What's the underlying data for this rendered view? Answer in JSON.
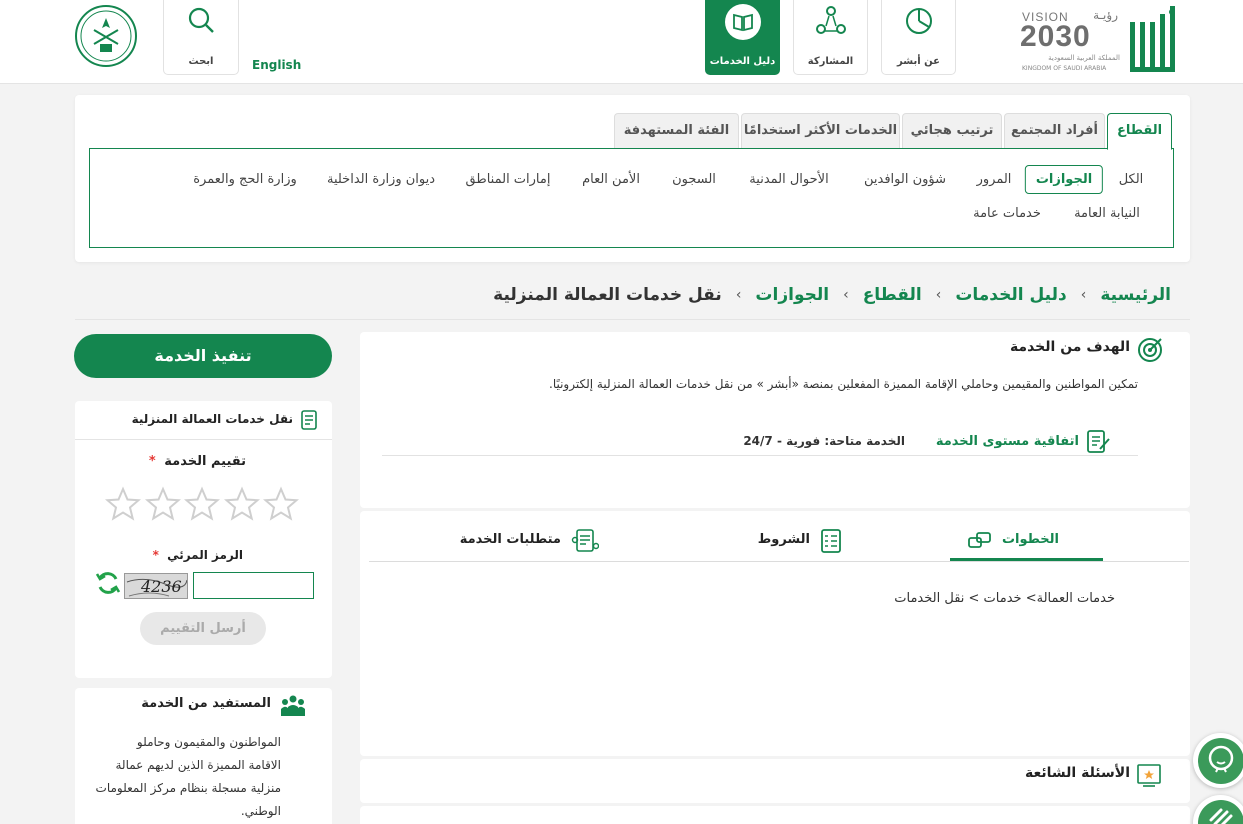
{
  "header": {
    "nav": {
      "about": "عن أبشر",
      "participation": "المشاركة",
      "services_guide": "دليل الخدمات",
      "search": "ابحث"
    },
    "english_link": "English",
    "vision": {
      "word": "VISION",
      "arabic_word": "رؤيـة",
      "year": "2030",
      "ksa_ar": "المملكة العربية السعودية",
      "ksa_en": "KINGDOM OF SAUDI ARABIA"
    },
    "absher_logo": "أبشر"
  },
  "sector_tabs": [
    "القطاع",
    "أفراد المجتمع",
    "ترتيب هجائي",
    "الخدمات الأكثر استخدامًا",
    "الفئة المستهدفة"
  ],
  "sectors_row1": [
    "الكل",
    "الجوازات",
    "المرور",
    "شؤون الوافدين",
    "الأحوال المدنية",
    "السجون",
    "الأمن العام",
    "إمارات المناطق",
    "ديوان وزارة الداخلية",
    "وزارة الحج والعمرة"
  ],
  "sectors_row2": [
    "النيابة العامة",
    "خدمات عامة"
  ],
  "selected_sector": "الجوازات",
  "breadcrumb": {
    "home": "الرئيسية",
    "guide": "دليل الخدمات",
    "sector": "القطاع",
    "passports": "الجوازات",
    "current": "نقل خدمات العمالة المنزلية",
    "separator": "›"
  },
  "goal": {
    "title": "الهدف من الخدمة",
    "text": "تمكين المواطنين والمقيمين وحاملي الإقامة المميزة المفعلين بمنصة «أبشر » من نقل خدمات العمالة المنزلية إلكترونيًا.",
    "sla_label": "اتفاقية مستوى الخدمة",
    "availability": "الخدمة متاحة: فورية - 24/7"
  },
  "service_tabs": {
    "steps": "الخطوات",
    "conditions": "الشروط",
    "requirements": "متطلبات الخدمة",
    "steps_content": "خدمات العمالة> خدمات > نقل الخدمات"
  },
  "faq": {
    "title": "الأسئلة الشائعة"
  },
  "sidebar": {
    "execute_button": "تنفيذ الخدمة",
    "service_name": "نقل خدمات العمالة المنزلية",
    "rating_label": "تقييم الخدمة",
    "required_mark": "*",
    "captcha_label": "الرمز المرئي",
    "captcha_code": "4236",
    "send_button": "أرسل التقييم",
    "beneficiary_title": "المستفيد من الخدمة",
    "beneficiary_lines": [
      "المواطنون والمقيمون وحاملو",
      "الاقامة المميزة الذين لديهم عمالة",
      "منزلية مسجلة بنظام مركز المعلومات",
      "الوطني."
    ]
  },
  "colors": {
    "primary": "#14864f",
    "background": "#f3f3f3",
    "star": "#cfcfcf",
    "required": "#e53935"
  },
  "rating": {
    "stars_total": 5,
    "stars_selected": 0
  }
}
